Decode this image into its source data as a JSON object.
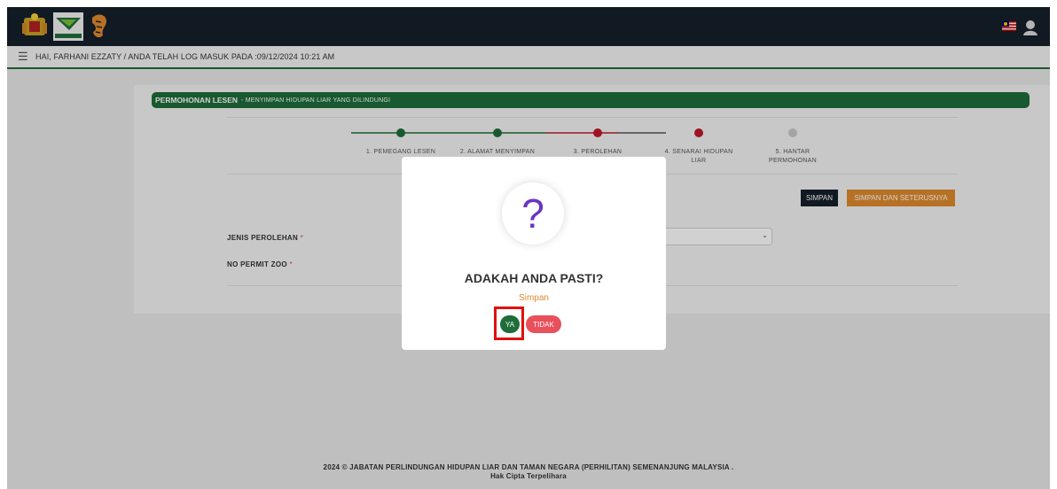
{
  "header": {
    "login_text": "HAI, FARHANI EZZATY / ANDA TELAH LOG MASUK PADA :09/12/2024 10:21 AM"
  },
  "card": {
    "title_bold": "PERMOHONAN LESEN",
    "title_rest": "- MENYIMPAN HIDUPAN LIAR YANG DILINDUNGI"
  },
  "steps": [
    {
      "line1": "1. PEMEGANG LESEN",
      "line2": "",
      "status": "done",
      "color": "#1f6d3a"
    },
    {
      "line1": "2. ALAMAT MENYIMPAN",
      "line2": "",
      "status": "done",
      "color": "#1f6d3a"
    },
    {
      "line1": "3. PEROLEHAN",
      "line2": "",
      "status": "current",
      "color": "#c0182a"
    },
    {
      "line1": "4. SENARAI HIDUPAN",
      "line2": "LIAR",
      "status": "next",
      "color": "#c0182a"
    },
    {
      "line1": "5. HANTAR",
      "line2": "PERMOHONAN",
      "status": "pending",
      "color": "#c8c8c8"
    }
  ],
  "buttons": {
    "simpan": "SIMPAN",
    "simpan_next": "SIMPAN DAN SETERUSNYA"
  },
  "form": {
    "jenis_label": "JENIS PEROLEHAN",
    "permit_label": "NO PERMIT ZOO",
    "required_mark": "*"
  },
  "modal": {
    "icon": "question-icon",
    "icon_glyph": "?",
    "title": "ADAKAH ANDA PASTI?",
    "subtitle": "Simpan",
    "yes_label": "YA",
    "no_label": "TIDAK"
  },
  "footer": {
    "line1": "2024 © JABATAN PERLINDUNGAN HIDUPAN LIAR DAN TAMAN NEGARA (PERHILITAN) SEMENANJUNG MALAYSIA .",
    "line2": "Hak Cipta Terpelihara"
  },
  "colors": {
    "topbar": "#151f2b",
    "brand_green": "#1f6d3a",
    "accent_orange": "#e08a2e",
    "danger_red": "#e8505b"
  }
}
